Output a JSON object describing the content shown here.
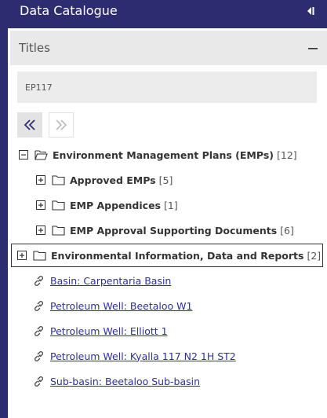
{
  "header": {
    "title": "Data Catalogue"
  },
  "titles_section": {
    "label": "Titles"
  },
  "search": {
    "value": "EP117"
  },
  "tree": [
    {
      "label": "Environment Management Plans (EMPs)",
      "count": "[12]",
      "expanded": true
    },
    {
      "label": "Approved EMPs",
      "count": "[5]",
      "expanded": false
    },
    {
      "label": "EMP Appendices",
      "count": "[1]",
      "expanded": false
    },
    {
      "label": "EMP Approval Supporting Documents",
      "count": "[6]",
      "expanded": false
    },
    {
      "label": "Environmental Information, Data and Reports",
      "count": "[2]",
      "expanded": false,
      "selected": true
    }
  ],
  "links": [
    "Basin: Carpentaria Basin",
    "Petroleum Well: Beetaloo W1",
    "Petroleum Well: Elliott 1",
    "Petroleum Well: Kyalla 117 N2 1H ST2",
    "Sub-basin: Beetaloo Sub-basin"
  ],
  "colors": {
    "header_bg": "#2e2c70",
    "link": "#2d2f9e",
    "panel_bg": "#ffffff"
  },
  "icons": [
    "collapse-panel-icon",
    "minus-icon",
    "double-chevron-left-icon",
    "double-chevron-right-icon",
    "plus-box-icon",
    "minus-box-icon",
    "folder-icon",
    "folder-open-icon",
    "link-icon"
  ]
}
